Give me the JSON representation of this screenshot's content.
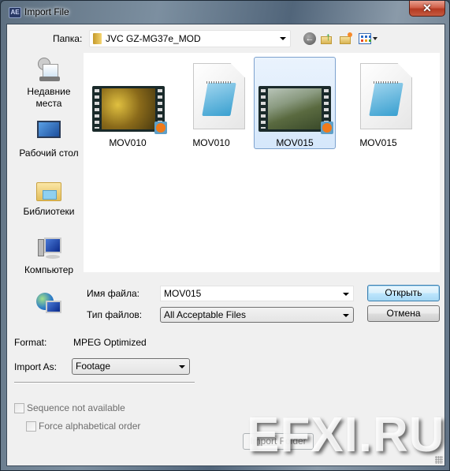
{
  "window": {
    "title": "Import File",
    "app_icon": "AE",
    "close_icon": "close-icon"
  },
  "toolbar": {
    "folder_label": "Папка:",
    "folder_value": "JVC GZ-MG37e_MOD",
    "icons": [
      "back-icon",
      "up-folder-icon",
      "new-folder-icon",
      "views-menu-icon"
    ]
  },
  "places": [
    {
      "label": "Недавние места",
      "icon": "recent-places-icon"
    },
    {
      "label": "Рабочий стол",
      "icon": "desktop-icon"
    },
    {
      "label": "Библиотеки",
      "icon": "libraries-icon"
    },
    {
      "label": "Компьютер",
      "icon": "computer-icon"
    },
    {
      "label": "",
      "icon": "network-icon"
    }
  ],
  "files": [
    {
      "name": "MOV010",
      "type": "video",
      "selected": false
    },
    {
      "name": "MOV010",
      "type": "document",
      "selected": false
    },
    {
      "name": "MOV015",
      "type": "video",
      "selected": true
    },
    {
      "name": "MOV015",
      "type": "document",
      "selected": false
    }
  ],
  "form": {
    "filename_label": "Имя файла:",
    "filename_value": "MOV015",
    "filetype_label": "Тип файлов:",
    "filetype_value": "All Acceptable Files",
    "open_button": "Открыть",
    "cancel_button": "Отмена"
  },
  "options": {
    "format_label": "Format:",
    "format_value": "MPEG Optimized",
    "import_as_label": "Import As:",
    "import_as_value": "Footage",
    "sequence_label": "Sequence not available",
    "sequence_checked": false,
    "alpha_label": "Force alphabetical order",
    "alpha_checked": false,
    "import_folder_button": "Import Folder"
  },
  "watermark": "EFXI.RU",
  "colors": {
    "selection_border": "#7da2ce",
    "default_button_border": "#3c7fb1",
    "close_button": "#c45a40"
  }
}
